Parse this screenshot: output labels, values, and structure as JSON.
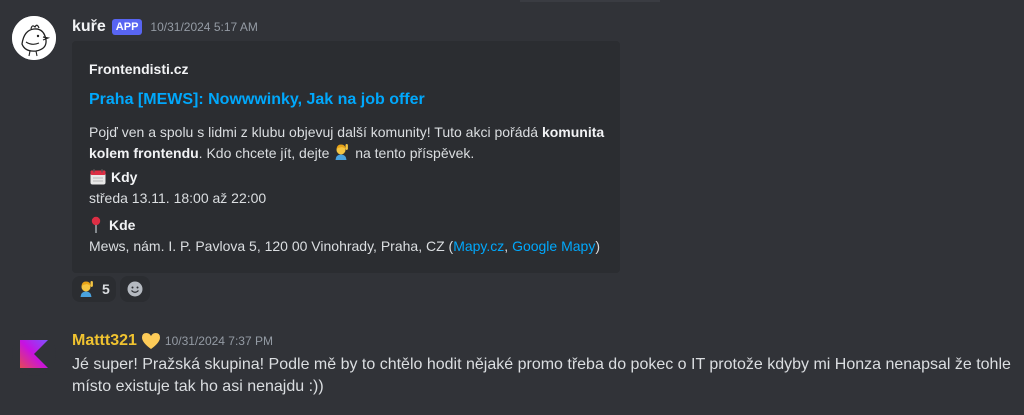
{
  "message1": {
    "username": "kuře",
    "badge": "APP",
    "timestamp": "10/31/2024 5:17 AM",
    "embed": {
      "provider": "Frontendisti.cz",
      "title": "Praha [MEWS]: Nowwwinky, Jak na job offer",
      "description": {
        "part1": "Pojď ven a spolu s lidmi z klubu objevuj další komunity! Tuto akci pořádá ",
        "bold": "komunita kolem frontendu",
        "part2": ". Kdo chcete jít, dejte ",
        "part3": " na tento příspěvek."
      },
      "when": {
        "icon": "calendar-icon",
        "label": "Kdy",
        "value": "středa 13.11. 18:00 až 22:00"
      },
      "where": {
        "icon": "pin-icon",
        "label": "Kde",
        "address": "Mews, nám. I. P. Pavlova 5, 120 00 Vinohrady, Praha, CZ (",
        "link1": "Mapy.cz",
        "separator": ", ",
        "link2": "Google Mapy",
        "close": ")"
      }
    },
    "reactions": [
      {
        "icon": "raising-hand-emoji-icon",
        "count": "5"
      }
    ],
    "add_reaction_icon": "add-reaction-icon"
  },
  "message2": {
    "username": "Mattt321",
    "badge_icon": "yellow-heart-icon",
    "timestamp": "10/31/2024 7:37 PM",
    "content": "Jé super! Pražská skupina! Podle mě by to chtělo hodit nějaké promo třeba do pokec o IT protože kdyby mi Honza nenapsal že tohle místo existuje tak ho asi nenajdu :))"
  },
  "colors": {
    "background": "#313338",
    "embed_background": "#2b2d31",
    "link": "#00a8fc",
    "app_badge": "#5865f2",
    "username2": "#f0c330"
  }
}
